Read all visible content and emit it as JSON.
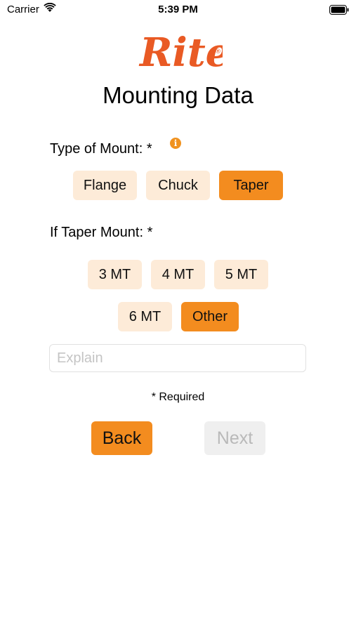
{
  "status_bar": {
    "carrier": "Carrier",
    "time": "5:39 PM"
  },
  "brand": {
    "logo_text": "Riten",
    "registered_mark": "®"
  },
  "page": {
    "title": "Mounting Data"
  },
  "mount_type": {
    "label": "Type of Mount: *",
    "info_glyph": "i",
    "options": [
      "Flange",
      "Chuck",
      "Taper"
    ],
    "selected": "Taper"
  },
  "taper_mount": {
    "label": "If Taper Mount: *",
    "options": [
      "3 MT",
      "4 MT",
      "5 MT",
      "6 MT",
      "Other"
    ],
    "selected": "Other"
  },
  "explain": {
    "placeholder": "Explain",
    "value": ""
  },
  "required_note": "* Required",
  "buttons": {
    "back": "Back",
    "next": "Next"
  },
  "colors": {
    "accent": "#f38c1f",
    "chip": "#fdebd8",
    "disabled": "#efefef",
    "logo": "#e95a24"
  },
  "icons": [
    "wifi-icon",
    "battery-icon",
    "info-icon"
  ]
}
